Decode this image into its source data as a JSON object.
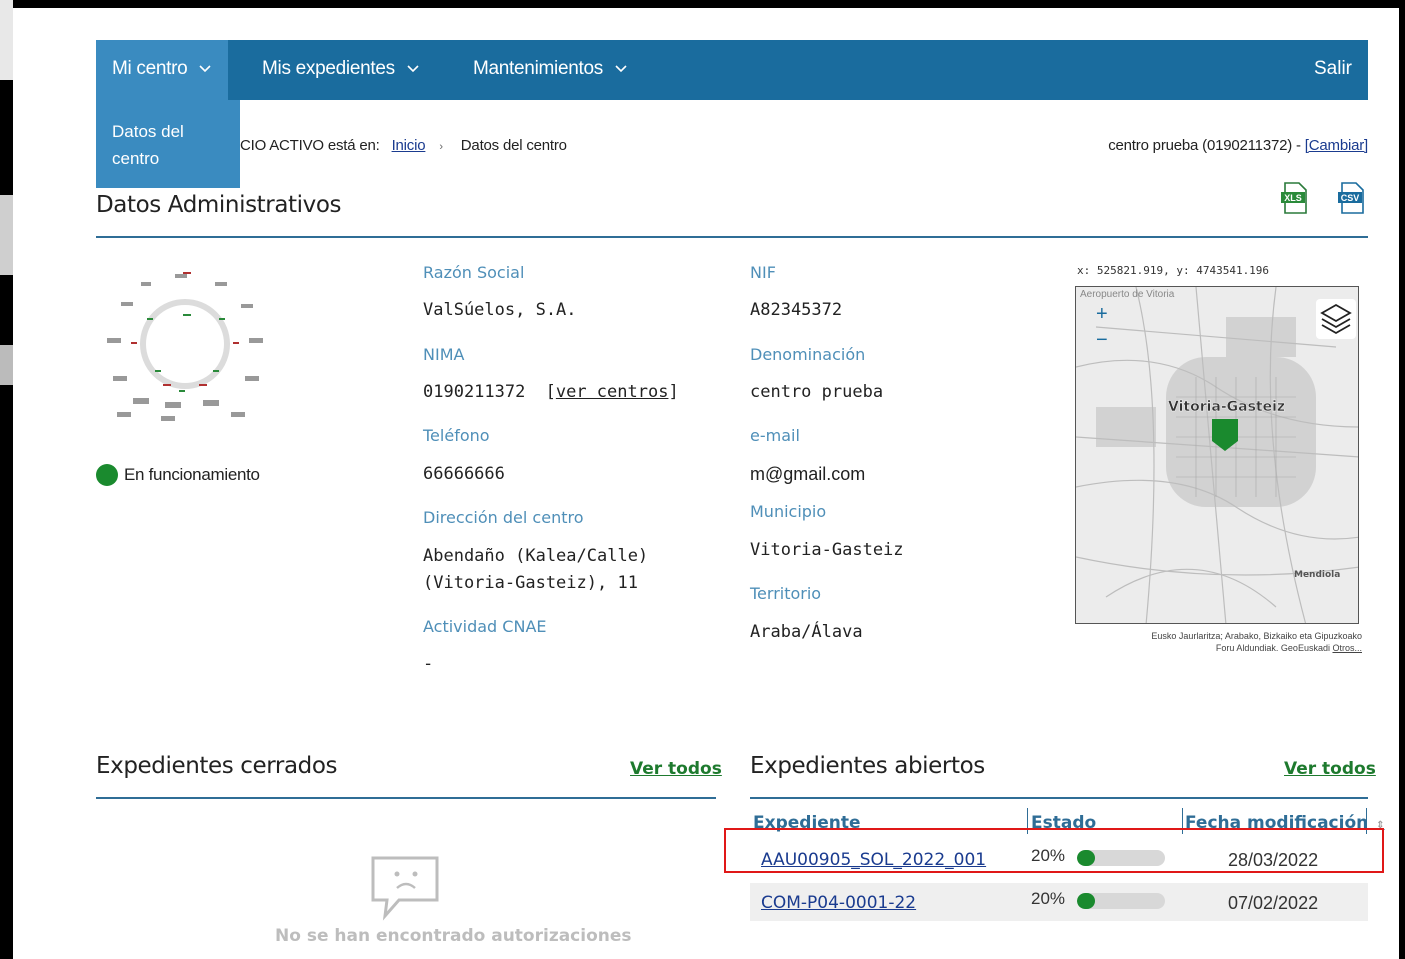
{
  "nav": {
    "items": [
      {
        "label": "Mi centro",
        "active": true
      },
      {
        "label": "Mis expedientes",
        "active": false
      },
      {
        "label": "Mantenimientos",
        "active": false
      }
    ],
    "logout": "Salir",
    "dropdown": [
      "Datos del",
      "centro"
    ]
  },
  "breadcrumb": {
    "prefix": "CIO ACTIVO está en:",
    "home": "Inicio",
    "current": "Datos del centro"
  },
  "centro": {
    "label": "centro prueba (0190211372) - ",
    "change": "[Cambiar]"
  },
  "exports": {
    "xls": "XLS",
    "csv": "CSV"
  },
  "admin": {
    "title": "Datos Administrativos",
    "status": "En funcionamiento",
    "status_color": "#1a8a2e",
    "fields": {
      "razon_label": "Razón Social",
      "razon_value": "ValSúelos, S.A.",
      "nif_label": "NIF",
      "nif_value": "A82345372",
      "nima_label": "NIMA",
      "nima_value": "0190211372",
      "nima_link": "ver centros",
      "denom_label": "Denominación",
      "denom_value": "centro prueba",
      "tel_label": "Teléfono",
      "tel_value": "66666666",
      "email_label": "e-mail",
      "email_value": "m@gmail.com",
      "dir_label": "Dirección del centro",
      "dir_value_1": "Abendaño (Kalea/Calle)",
      "dir_value_2": "(Vitoria-Gasteiz), 11",
      "muni_label": "Municipio",
      "muni_value": "Vitoria-Gasteiz",
      "cnae_label": "Actividad CNAE",
      "cnae_value": "-",
      "terr_label": "Territorio",
      "terr_value": "Araba/Álava"
    }
  },
  "map": {
    "coords": "x: 525821.919, y: 4743541.196",
    "city_label": "Vitoria-Gasteiz",
    "top_label": "Aeropuerto de Vitoria",
    "side_label": "Mendiola",
    "zoom_in": "+",
    "zoom_out": "−",
    "attribution_1": "Eusko Jaurlaritza; Arabako, Bizkaiko eta Gipuzkoako",
    "attribution_2": "Foru Aldundiak. GeoEuskadi",
    "attribution_link": "Otros...",
    "marker_color": "#1a8a2e"
  },
  "closed": {
    "title": "Expedientes cerrados",
    "view_all": "Ver todos",
    "empty": "No se han encontrado autorizaciones"
  },
  "open": {
    "title": "Expedientes abiertos",
    "view_all": "Ver todos",
    "headers": [
      "Expediente",
      "Estado",
      "Fecha modificación"
    ],
    "rows": [
      {
        "id": "AAU00905_SOL_2022_001",
        "percent": "20%",
        "progress": 0.2,
        "date": "28/03/2022"
      },
      {
        "id": "COM-P04-0001-22",
        "percent": "20%",
        "progress": 0.2,
        "date": "07/02/2022"
      }
    ]
  }
}
